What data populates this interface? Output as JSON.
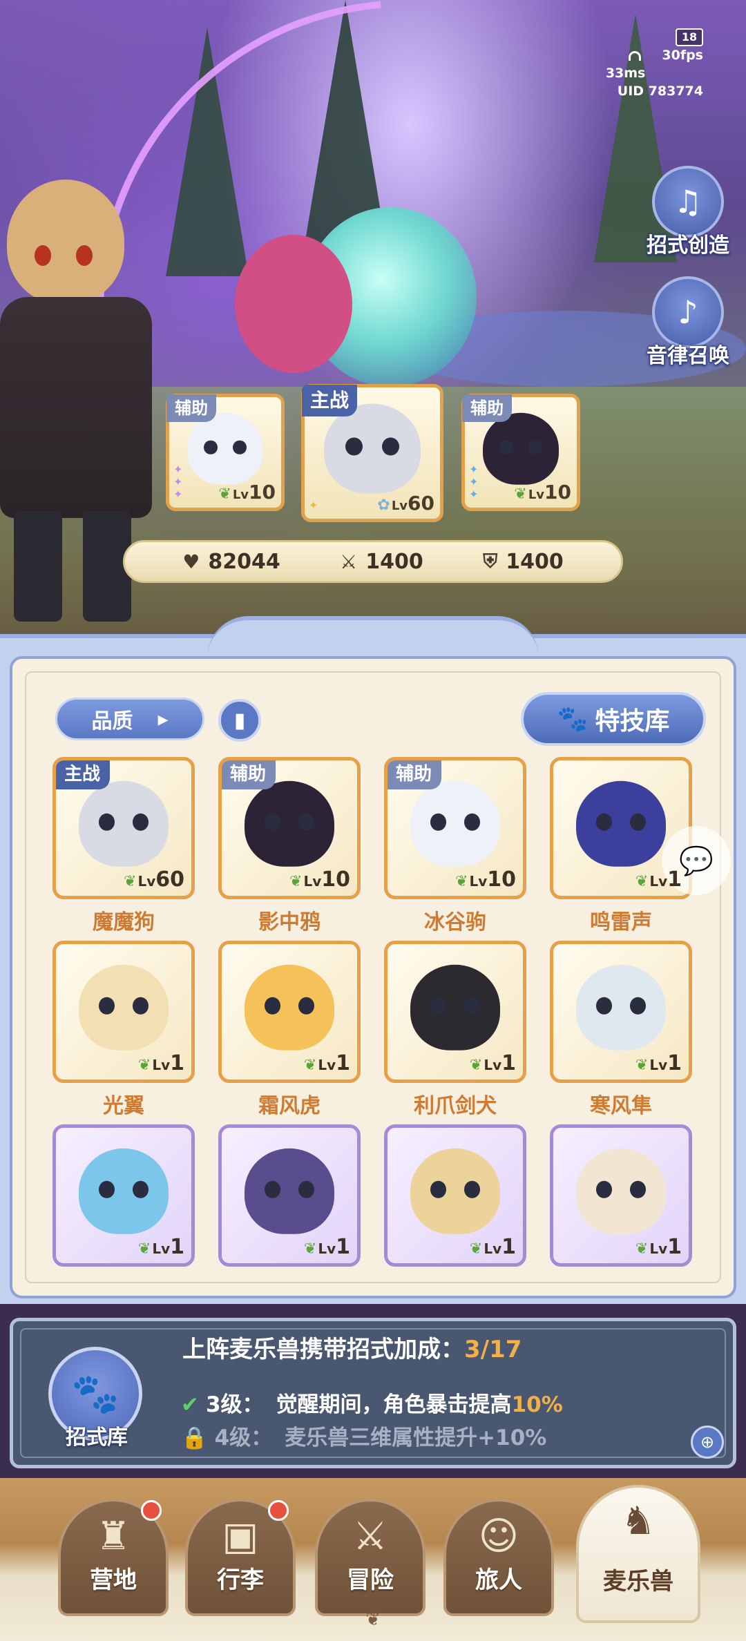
{
  "hud": {
    "age_rating": "18",
    "ping": "33ms",
    "fps": "30fps",
    "uid": "UID 783774"
  },
  "side_buttons": [
    {
      "label": "招式创造",
      "icon": "book-music-icon"
    },
    {
      "label": "音律召唤",
      "icon": "lyre-icon"
    }
  ],
  "formation": [
    {
      "tag": "辅助",
      "level_prefix": "Lv",
      "level": "10",
      "rarity": "purple"
    },
    {
      "tag": "主战",
      "level_prefix": "Lv",
      "level": "60",
      "rarity": "gold"
    },
    {
      "tag": "辅助",
      "level_prefix": "Lv",
      "level": "10",
      "rarity": "blue"
    }
  ],
  "stats": {
    "hp": "82044",
    "attack": "1400",
    "defense": "1400"
  },
  "filters": {
    "quality_label": "品质",
    "quality_arrow": "▸",
    "codex_icon": "book-icon",
    "skill_library_label": "特技库"
  },
  "pets": [
    {
      "name": "魔魔狗",
      "tag": "主战",
      "level": "60",
      "frame": "gold",
      "color": "#d8dbe4"
    },
    {
      "name": "影中鸦",
      "tag": "辅助",
      "level": "10",
      "frame": "gold",
      "color": "#2c2436"
    },
    {
      "name": "冰谷驹",
      "tag": "辅助",
      "level": "10",
      "frame": "gold",
      "color": "#eef1f8"
    },
    {
      "name": "鸣雷声",
      "tag": "",
      "level": "1",
      "frame": "gold",
      "color": "#3c3f9c"
    },
    {
      "name": "光翼",
      "tag": "",
      "level": "1",
      "frame": "gold",
      "color": "#f3dfb4"
    },
    {
      "name": "霜风虎",
      "tag": "",
      "level": "1",
      "frame": "gold",
      "color": "#f5c25a"
    },
    {
      "name": "利爪剑犬",
      "tag": "",
      "level": "1",
      "frame": "gold",
      "color": "#2c2a2e"
    },
    {
      "name": "寒风隼",
      "tag": "",
      "level": "1",
      "frame": "gold",
      "color": "#dfe8ef"
    },
    {
      "name": "",
      "tag": "",
      "level": "1",
      "frame": "purple",
      "color": "#7cc6ec"
    },
    {
      "name": "",
      "tag": "",
      "level": "1",
      "frame": "purple",
      "color": "#5a4d8e"
    },
    {
      "name": "",
      "tag": "",
      "level": "1",
      "frame": "purple",
      "color": "#ecd39a"
    },
    {
      "name": "",
      "tag": "",
      "level": "1",
      "frame": "purple",
      "color": "#f2e6d2"
    }
  ],
  "level_prefix": "Lv",
  "bonus": {
    "title": "上阵麦乐兽携带招式加成：",
    "count": "3/17",
    "line1_level": "3级：",
    "line1_text": "觉醒期间，角色暴击提高",
    "line1_value": "10%",
    "line2_level": "4级：",
    "line2_text": "麦乐兽三维属性提升+10%",
    "library_label": "招式库"
  },
  "nav": [
    {
      "label": "营地",
      "icon": "castle-icon",
      "dot": true,
      "active": false
    },
    {
      "label": "行李",
      "icon": "chest-icon",
      "dot": true,
      "active": false
    },
    {
      "label": "冒险",
      "icon": "crossed-swords-icon",
      "dot": false,
      "active": false
    },
    {
      "label": "旅人",
      "icon": "traveler-icon",
      "dot": false,
      "active": false
    },
    {
      "label": "麦乐兽",
      "icon": "pet-icon",
      "dot": false,
      "active": true
    }
  ]
}
